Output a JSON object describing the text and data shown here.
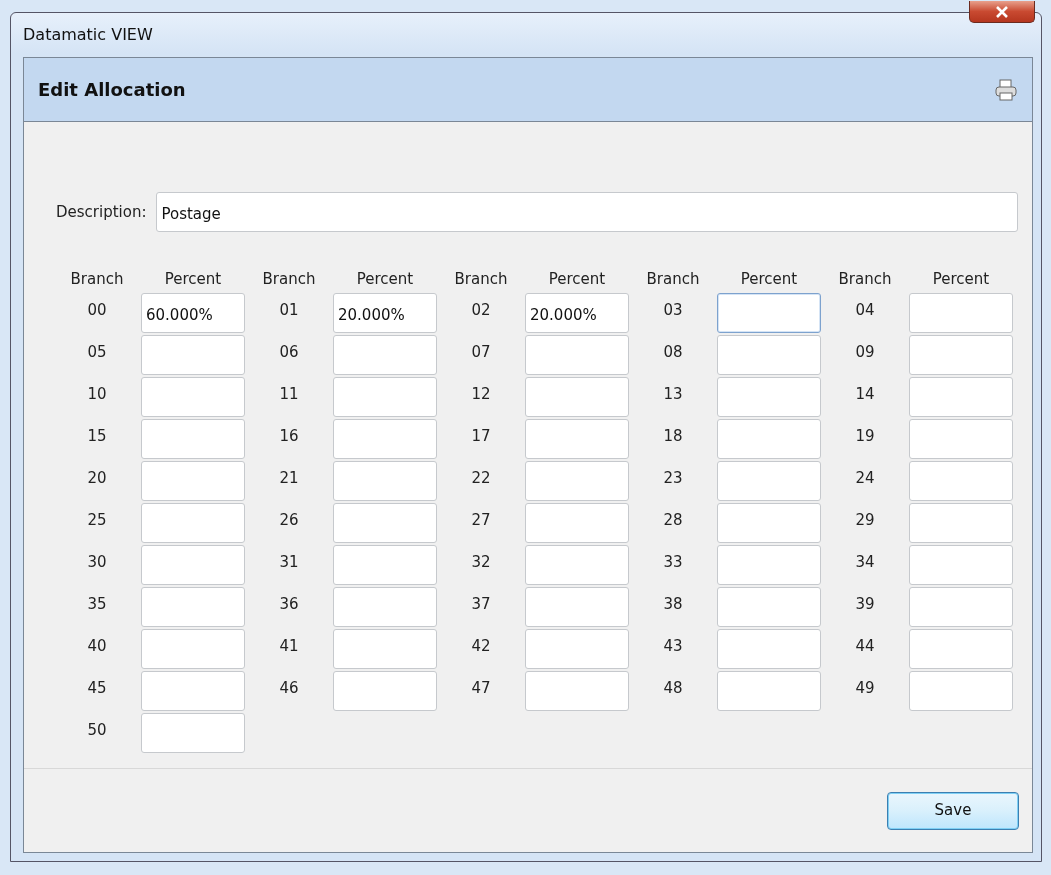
{
  "window": {
    "title": "Datamatic VIEW"
  },
  "header": {
    "title": "Edit Allocation"
  },
  "description": {
    "label": "Description:",
    "value": "Postage"
  },
  "grid_headers": [
    "Branch",
    "Percent",
    "Branch",
    "Percent",
    "Branch",
    "Percent",
    "Branch",
    "Percent",
    "Branch",
    "Percent"
  ],
  "allocations": [
    {
      "branch": "00",
      "percent": "60.000%",
      "focused": false
    },
    {
      "branch": "01",
      "percent": "20.000%",
      "focused": false
    },
    {
      "branch": "02",
      "percent": "20.000%",
      "focused": false
    },
    {
      "branch": "03",
      "focused": true
    },
    {
      "branch": "04",
      "focused": false
    },
    {
      "branch": "05",
      "focused": false
    },
    {
      "branch": "06",
      "focused": false
    },
    {
      "branch": "07",
      "focused": false
    },
    {
      "branch": "08",
      "focused": false
    },
    {
      "branch": "09",
      "focused": false
    },
    {
      "branch": "10",
      "focused": false
    },
    {
      "branch": "11",
      "focused": false
    },
    {
      "branch": "12",
      "focused": false
    },
    {
      "branch": "13",
      "focused": false
    },
    {
      "branch": "14",
      "focused": false
    },
    {
      "branch": "15",
      "focused": false
    },
    {
      "branch": "16",
      "focused": false
    },
    {
      "branch": "17",
      "focused": false
    },
    {
      "branch": "18",
      "focused": false
    },
    {
      "branch": "19",
      "focused": false
    },
    {
      "branch": "20",
      "focused": false
    },
    {
      "branch": "21",
      "focused": false
    },
    {
      "branch": "22",
      "focused": false
    },
    {
      "branch": "23",
      "focused": false
    },
    {
      "branch": "24",
      "focused": false
    },
    {
      "branch": "25",
      "focused": false
    },
    {
      "branch": "26",
      "focused": false
    },
    {
      "branch": "27",
      "focused": false
    },
    {
      "branch": "28",
      "focused": false
    },
    {
      "branch": "29",
      "focused": false
    },
    {
      "branch": "30",
      "focused": false
    },
    {
      "branch": "31",
      "focused": false
    },
    {
      "branch": "32",
      "focused": false
    },
    {
      "branch": "33",
      "focused": false
    },
    {
      "branch": "34",
      "focused": false
    },
    {
      "branch": "35",
      "focused": false
    },
    {
      "branch": "36",
      "focused": false
    },
    {
      "branch": "37",
      "focused": false
    },
    {
      "branch": "38",
      "focused": false
    },
    {
      "branch": "39",
      "focused": false
    },
    {
      "branch": "40",
      "focused": false
    },
    {
      "branch": "41",
      "focused": false
    },
    {
      "branch": "42",
      "focused": false
    },
    {
      "branch": "43",
      "focused": false
    },
    {
      "branch": "44",
      "focused": false
    },
    {
      "branch": "45",
      "focused": false
    },
    {
      "branch": "46",
      "focused": false
    },
    {
      "branch": "47",
      "focused": false
    },
    {
      "branch": "48",
      "focused": false
    },
    {
      "branch": "49",
      "focused": false
    },
    {
      "branch": "50",
      "focused": false
    }
  ],
  "buttons": [
    {
      "label": "Save"
    }
  ]
}
